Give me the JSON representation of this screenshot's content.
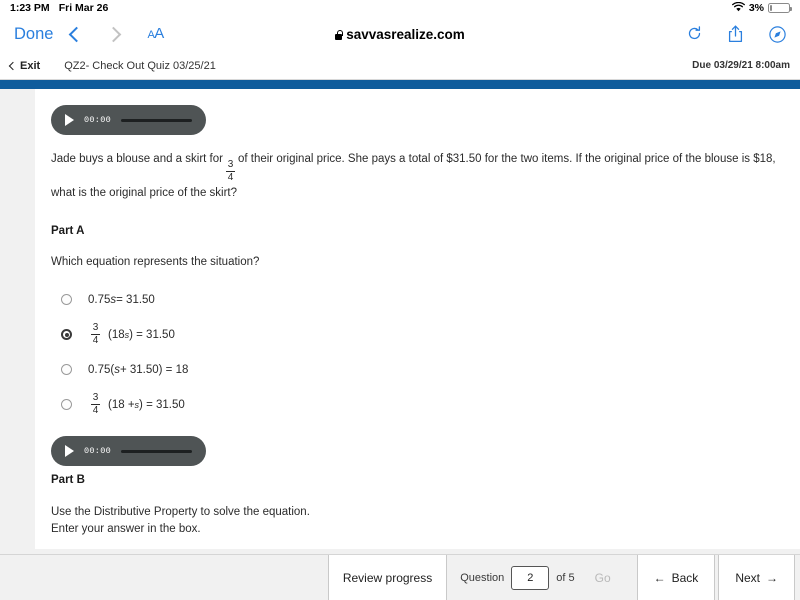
{
  "status_bar": {
    "time": "1:23 PM",
    "date": "Fri Mar 26",
    "battery_percent": "3%",
    "wifi_icon": "wifi-icon",
    "battery_icon": "battery-icon"
  },
  "browser": {
    "done_label": "Done",
    "back_icon": "chevron-left-icon",
    "forward_icon": "chevron-right-icon",
    "text_size_label_small": "A",
    "text_size_label_large": "A",
    "url": "savvasrealize.com",
    "lock_icon": "lock-icon",
    "reload_icon": "reload-icon",
    "share_icon": "share-icon",
    "compass_icon": "compass-icon"
  },
  "quiz_header": {
    "exit_label": "Exit",
    "exit_icon": "chevron-left-icon",
    "title": "QZ2- Check Out Quiz 03/25/21",
    "due": "Due 03/29/21 8:00am",
    "accent_color": "#0f5c9c"
  },
  "audio_players": [
    {
      "time": "00:00",
      "play_icon": "play-icon"
    },
    {
      "time": "00:00",
      "play_icon": "play-icon"
    }
  ],
  "question": {
    "text_part1": "Jade buys a blouse and a skirt for",
    "fraction_numerator": "3",
    "fraction_denominator": "4",
    "text_part2": "of their original price. She pays a total of $31.50 for the two items. If the original price of the blouse is $18, what is the original price of the skirt?"
  },
  "part_a": {
    "label": "Part A",
    "prompt": "Which equation represents the situation?",
    "choices": [
      {
        "id": "a",
        "text": "0.75s = 31.50",
        "selected": false
      },
      {
        "id": "b",
        "text": "3/4 (18s) = 31.50",
        "selected": true
      },
      {
        "id": "c",
        "text": "0.75(s + 31.50) = 18",
        "selected": false
      },
      {
        "id": "d",
        "text": "3/4 (18 + s) = 31.50",
        "selected": false
      }
    ],
    "choice_a": {
      "prefix": "0.75",
      "var": "s",
      "suffix": " = 31.50"
    },
    "choice_b": {
      "num": "3",
      "den": "4",
      "open": "(18",
      "var": "s",
      "suffix": ") = 31.50"
    },
    "choice_c": {
      "prefix": "0.75(",
      "var": "s",
      "suffix": " + 31.50) = 18"
    },
    "choice_d": {
      "num": "3",
      "den": "4",
      "open": "(18 + ",
      "var": "s",
      "suffix": ") = 31.50"
    }
  },
  "part_b": {
    "label": "Part B",
    "line1": "Use the Distributive Property to solve the equation.",
    "line2": "Enter your answer in the box.",
    "dollar_sign": "$",
    "answer_value": "",
    "answer_placeholder": ""
  },
  "footer": {
    "review_label": "Review progress",
    "question_label": "Question",
    "question_number": "2",
    "of_label": "of 5",
    "go_label": "Go",
    "go_enabled": false,
    "back_label": "Back",
    "back_icon": "arrow-left-icon",
    "next_label": "Next",
    "next_icon": "arrow-right-icon"
  }
}
